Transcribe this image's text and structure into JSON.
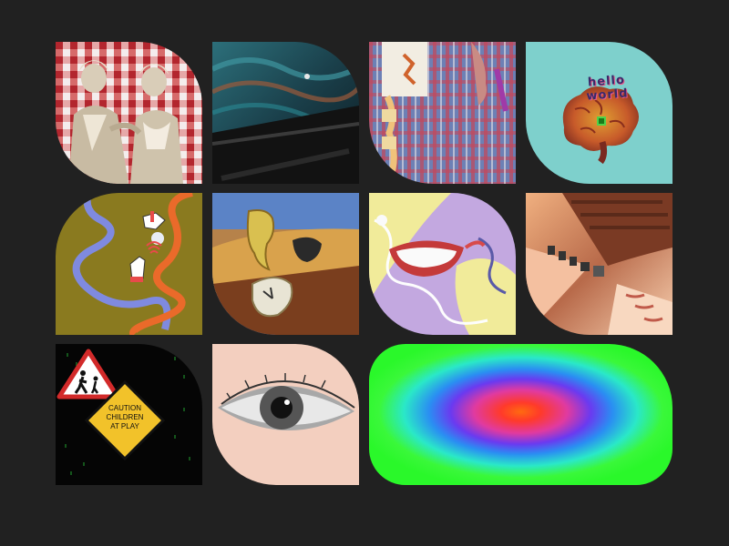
{
  "gallery": {
    "background": "#212121",
    "tiles": [
      {
        "name": "vintage-women-gingham-collage"
      },
      {
        "name": "textured-fabric-closeup"
      },
      {
        "name": "embroidery-on-plaid-fabric"
      },
      {
        "name": "brain-hello-world"
      },
      {
        "name": "hands-wifi-illustration"
      },
      {
        "name": "melting-clocks-surreal"
      },
      {
        "name": "smiling-mouth-earphones"
      },
      {
        "name": "repeated-faces-camera-tunnel"
      },
      {
        "name": "caution-children-sign"
      },
      {
        "name": "eye-collage"
      },
      {
        "name": "heatmap-gradient"
      }
    ]
  },
  "brain": {
    "text": "hello world"
  },
  "caution_sign": {
    "line1": "CAUTION",
    "line2": "CHILDREN",
    "line3": "AT PLAY"
  }
}
